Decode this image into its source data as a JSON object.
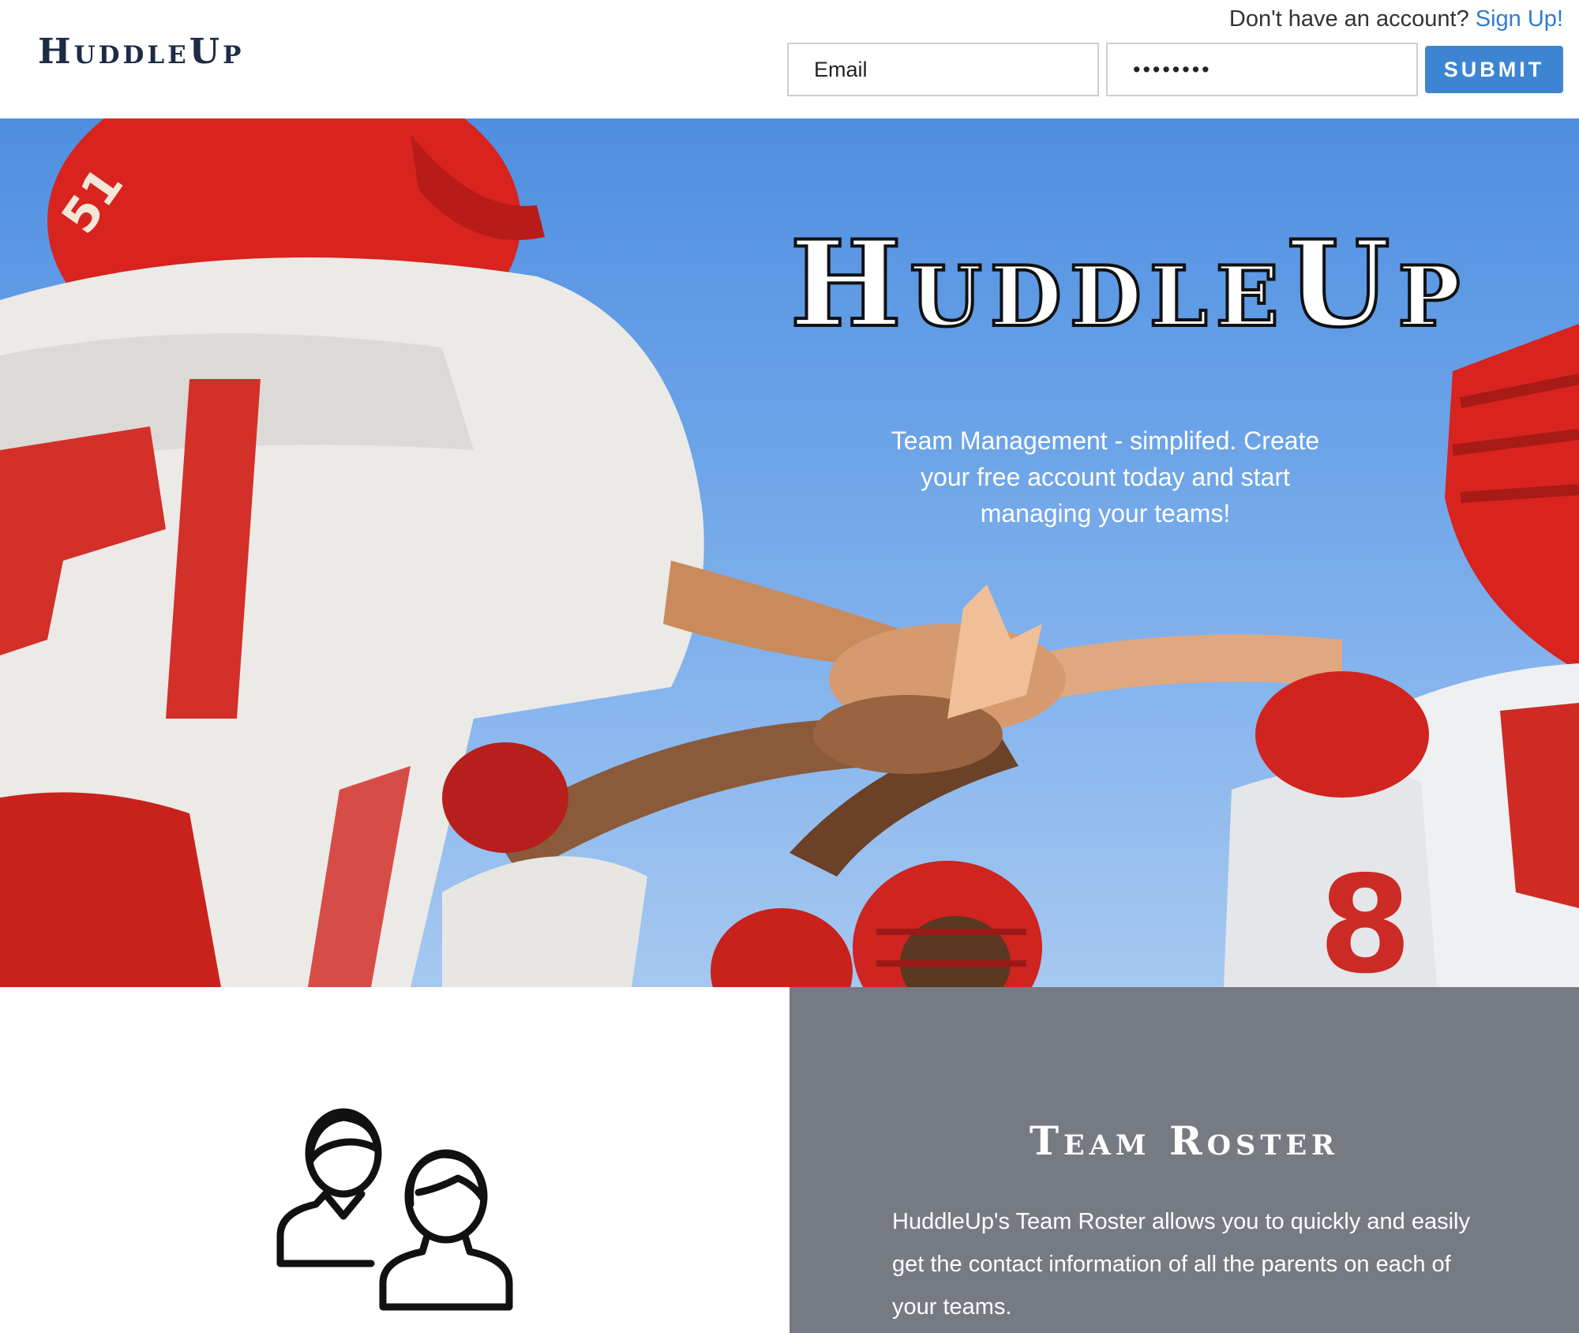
{
  "header": {
    "logo": "HuddleUp",
    "account_prompt": "Don't have an account?",
    "signup_link": "Sign Up!",
    "email_placeholder": "Email",
    "password_value": "••••••••",
    "submit_label": "SUBMIT"
  },
  "hero": {
    "title": "HuddleUp",
    "subtitle": "Team Management - simplifed. Create your free account today and start managing your teams!",
    "image": "football-team-huddle-hands-together"
  },
  "feature": {
    "icon": "team-roster-people-icon",
    "title": "Team Roster",
    "description": "HuddleUp's Team Roster allows you to quickly and easily get the contact information of all the parents on each of your teams."
  },
  "colors": {
    "brand_dark": "#1d2b45",
    "accent": "#3e85d1",
    "link": "#2e7ccf",
    "feature_panel": "#767b83"
  }
}
